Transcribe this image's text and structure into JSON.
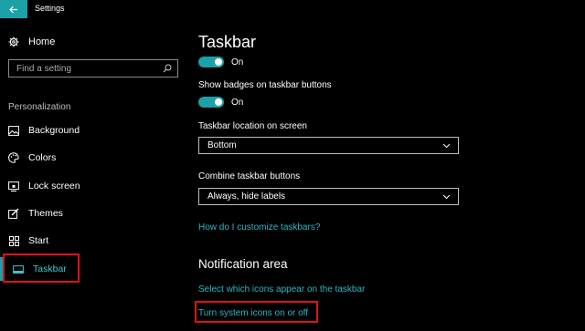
{
  "window": {
    "title": "Settings"
  },
  "sidebar": {
    "home_label": "Home",
    "search_placeholder": "Find a setting",
    "section_label": "Personalization",
    "items": [
      {
        "label": "Background",
        "icon": "image-icon"
      },
      {
        "label": "Colors",
        "icon": "palette-icon"
      },
      {
        "label": "Lock screen",
        "icon": "lock-screen-icon"
      },
      {
        "label": "Themes",
        "icon": "themes-brush-icon"
      },
      {
        "label": "Start",
        "icon": "start-grid-icon"
      },
      {
        "label": "Taskbar",
        "icon": "taskbar-icon",
        "active": true
      }
    ]
  },
  "main": {
    "title": "Taskbar",
    "toggle1": {
      "state_label": "On"
    },
    "badges_label": "Show badges on taskbar buttons",
    "toggle2": {
      "state_label": "On"
    },
    "location_label": "Taskbar location on screen",
    "location_value": "Bottom",
    "combine_label": "Combine taskbar buttons",
    "combine_value": "Always, hide labels",
    "help_link": "How do I customize taskbars?",
    "notification_heading": "Notification area",
    "link_select_icons": "Select which icons appear on the taskbar",
    "link_system_icons": "Turn system icons on or off"
  },
  "colors": {
    "accent": "#1ba1a8",
    "link": "#2fb6c0",
    "highlight": "#e01020"
  }
}
